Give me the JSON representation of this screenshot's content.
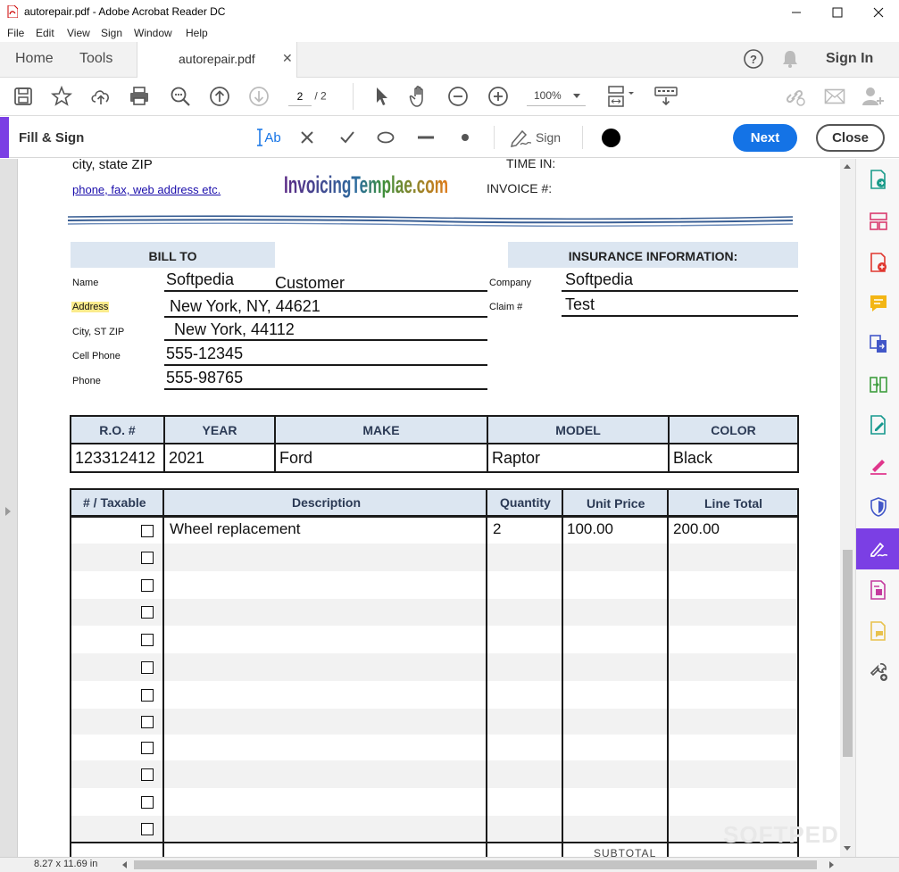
{
  "window": {
    "title": "autorepair.pdf - Adobe Acrobat Reader DC"
  },
  "menu": [
    "File",
    "Edit",
    "View",
    "Sign",
    "Window",
    "Help"
  ],
  "tabs": {
    "home": "Home",
    "tools": "Tools",
    "document": "autorepair.pdf",
    "sign_in": "Sign In"
  },
  "toolbar": {
    "current_page": "2",
    "page_total": "/ 2",
    "zoom": "100%"
  },
  "fill_sign": {
    "label": "Fill & Sign",
    "text_tool": "Ab",
    "sign_label": "Sign",
    "next": "Next",
    "close": "Close"
  },
  "invoice": {
    "address_line": "city, state ZIP",
    "contact_link": "phone, fax, web address etc.",
    "logo_text": "InvoicingTemplae.com",
    "time_in_label": "TIME IN:",
    "invoice_no_label": "INVOICE #:",
    "bill_to": {
      "heading": "BILL TO",
      "name_label": "Name",
      "name_value": "Softpedia",
      "name_value_2": "Customer",
      "address_label": "Address",
      "address_value": "New York, NY, 44621",
      "city_label": "City, ST ZIP",
      "city_value": "New York, 44112",
      "cell_label": "Cell Phone",
      "cell_value": "555-12345",
      "phone_label": "Phone",
      "phone_value": "555-98765"
    },
    "insurance": {
      "heading": "INSURANCE INFORMATION:",
      "company_label": "Company",
      "company_value": "Softpedia",
      "claim_label": "Claim #",
      "claim_value": "Test"
    },
    "vehicle": {
      "headers": [
        "R.O. #",
        "YEAR",
        "MAKE",
        "MODEL",
        "COLOR"
      ],
      "values": [
        "123312412",
        "2021",
        "Ford",
        "Raptor",
        "Black"
      ]
    },
    "items": {
      "headers": [
        "# / Taxable",
        "Description",
        "Quantity",
        "Unit Price",
        "Line Total"
      ],
      "rows": [
        {
          "description": "Wheel replacement",
          "quantity": "2",
          "unit_price": "100.00",
          "line_total": "200.00"
        },
        {
          "description": "",
          "quantity": "",
          "unit_price": "",
          "line_total": ""
        },
        {
          "description": "",
          "quantity": "",
          "unit_price": "",
          "line_total": ""
        },
        {
          "description": "",
          "quantity": "",
          "unit_price": "",
          "line_total": ""
        },
        {
          "description": "",
          "quantity": "",
          "unit_price": "",
          "line_total": ""
        },
        {
          "description": "",
          "quantity": "",
          "unit_price": "",
          "line_total": ""
        },
        {
          "description": "",
          "quantity": "",
          "unit_price": "",
          "line_total": ""
        },
        {
          "description": "",
          "quantity": "",
          "unit_price": "",
          "line_total": ""
        },
        {
          "description": "",
          "quantity": "",
          "unit_price": "",
          "line_total": ""
        },
        {
          "description": "",
          "quantity": "",
          "unit_price": "",
          "line_total": ""
        },
        {
          "description": "",
          "quantity": "",
          "unit_price": "",
          "line_total": ""
        },
        {
          "description": "",
          "quantity": "",
          "unit_price": "",
          "line_total": ""
        }
      ],
      "subtotal_label": "SUBTOTAL"
    }
  },
  "status": {
    "page_size": "8.27 x 11.69 in"
  },
  "watermark": "SOFTPEDIA",
  "colors": {
    "accent_purple": "#7b3fe4",
    "next_blue": "#1473e6",
    "header_fill": "#dce6f1"
  }
}
